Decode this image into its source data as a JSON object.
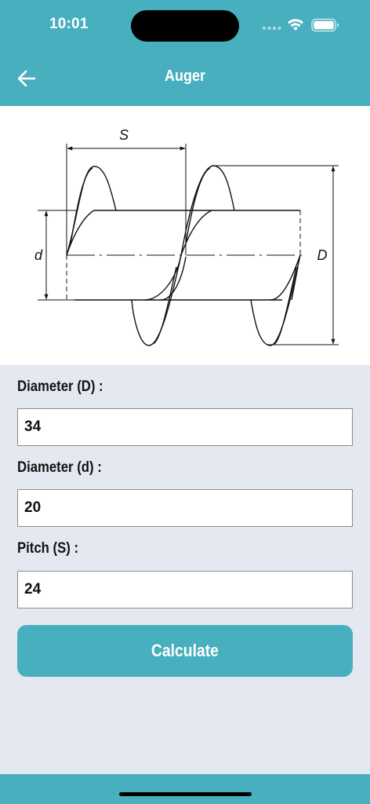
{
  "status_bar": {
    "time": "10:01"
  },
  "header": {
    "title": "Auger"
  },
  "diagram": {
    "label_S": "S",
    "label_d": "d",
    "label_D": "D"
  },
  "form": {
    "fields": [
      {
        "label": "Diameter (D) :",
        "value": "34"
      },
      {
        "label": "Diameter (d) :",
        "value": "20"
      },
      {
        "label": "Pitch (S) :",
        "value": "24"
      }
    ],
    "calculate_label": "Calculate"
  },
  "colors": {
    "accent": "#47afbd",
    "background": "#e3e8f1"
  }
}
